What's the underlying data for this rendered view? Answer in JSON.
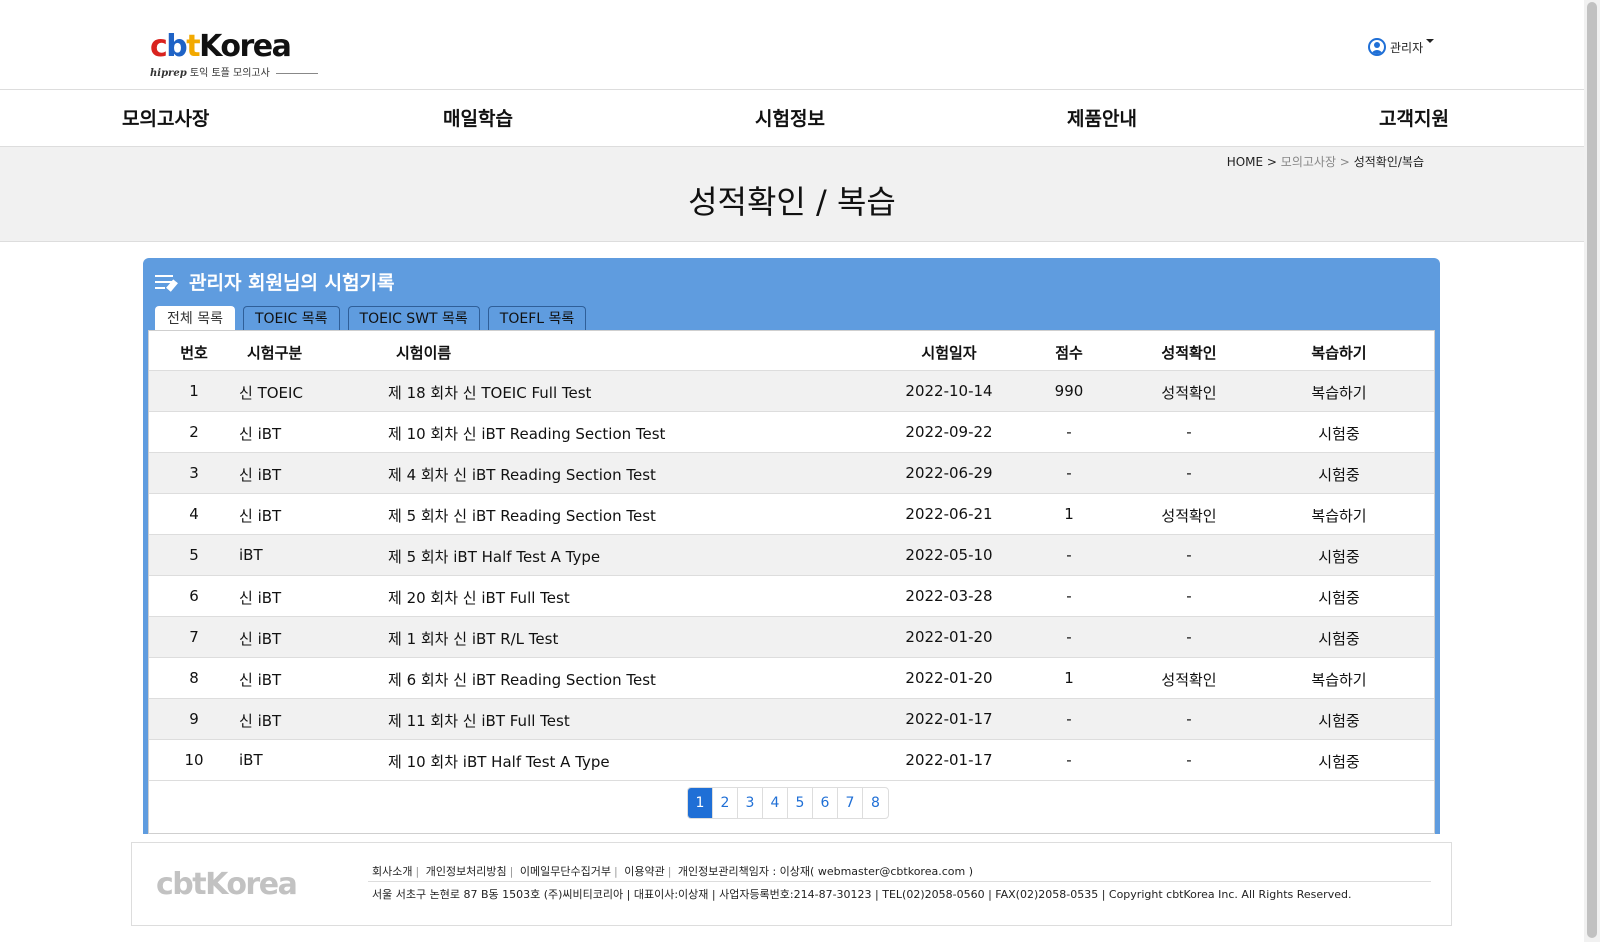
{
  "header": {
    "logo": {
      "c": "c",
      "b": "b",
      "t": "t",
      "korea": "Korea",
      "sub_brand": "hiprep",
      "sub_text": "토익 토플 모의고사"
    },
    "user_label": "관리자"
  },
  "nav": {
    "items": [
      "모의고사장",
      "매일학습",
      "시험정보",
      "제품안내",
      "고객지원"
    ]
  },
  "breadcrumb": {
    "home": "HOME >",
    "section": "모의고사장 >",
    "current": "성적확인/복습"
  },
  "page_title": "성적확인 / 복습",
  "panel": {
    "title": "관리자 회원님의 시험기록",
    "tabs": [
      "전체 목록",
      "TOEIC 목록",
      "TOEIC SWT 목록",
      "TOEFL 목록"
    ],
    "active_tab": 0
  },
  "table": {
    "headers": {
      "num": "번호",
      "type": "시험구분",
      "name": "시험이름",
      "date": "시험일자",
      "score": "점수",
      "result": "성적확인",
      "review": "복습하기"
    },
    "rows": [
      {
        "num": "1",
        "type": "신 TOEIC",
        "name": "제 18 회차 신 TOEIC Full Test",
        "date": "2022-10-14",
        "score": "990",
        "result": "성적확인",
        "review": "복습하기"
      },
      {
        "num": "2",
        "type": "신 iBT",
        "name": "제 10 회차 신 iBT Reading Section Test",
        "date": "2022-09-22",
        "score": "-",
        "result": "-",
        "review": "시험중"
      },
      {
        "num": "3",
        "type": "신 iBT",
        "name": "제 4 회차 신 iBT Reading Section Test",
        "date": "2022-06-29",
        "score": "-",
        "result": "-",
        "review": "시험중"
      },
      {
        "num": "4",
        "type": "신 iBT",
        "name": "제 5 회차 신 iBT Reading Section Test",
        "date": "2022-06-21",
        "score": "1",
        "result": "성적확인",
        "review": "복습하기"
      },
      {
        "num": "5",
        "type": "iBT",
        "name": "제 5 회차 iBT Half Test A Type",
        "date": "2022-05-10",
        "score": "-",
        "result": "-",
        "review": "시험중"
      },
      {
        "num": "6",
        "type": "신 iBT",
        "name": "제 20 회차 신 iBT Full Test",
        "date": "2022-03-28",
        "score": "-",
        "result": "-",
        "review": "시험중"
      },
      {
        "num": "7",
        "type": "신 iBT",
        "name": "제 1 회차 신 iBT R/L Test",
        "date": "2022-01-20",
        "score": "-",
        "result": "-",
        "review": "시험중"
      },
      {
        "num": "8",
        "type": "신 iBT",
        "name": "제 6 회차 신 iBT Reading Section Test",
        "date": "2022-01-20",
        "score": "1",
        "result": "성적확인",
        "review": "복습하기"
      },
      {
        "num": "9",
        "type": "신 iBT",
        "name": "제 11 회차 신 iBT Full Test",
        "date": "2022-01-17",
        "score": "-",
        "result": "-",
        "review": "시험중"
      },
      {
        "num": "10",
        "type": "iBT",
        "name": "제 10 회차 iBT Half Test A Type",
        "date": "2022-01-17",
        "score": "-",
        "result": "-",
        "review": "시험중"
      }
    ]
  },
  "pagination": {
    "pages": [
      "1",
      "2",
      "3",
      "4",
      "5",
      "6",
      "7",
      "8"
    ],
    "current": "1"
  },
  "footer": {
    "logo": "cbtKorea",
    "links": [
      "회사소개",
      "개인정보처리방침",
      "이메일무단수집거부",
      "이용약관"
    ],
    "privacy_officer": "개인정보관리책임자 : 이상재(  webmaster@cbtkorea.com  )",
    "info": "서울 서초구 논현로 87 B동 1503호 (주)씨비티코리아 | 대표이사:이상재 | 사업자등록번호:214-87-30123 | TEL(02)2058-0560 | FAX(02)2058-0535 | Copyright cbtKorea Inc. All Rights Reserved."
  },
  "colors": {
    "panel_blue": "#5f9cdf",
    "link_blue": "#1f6fd6",
    "logo_red": "#d9231f",
    "logo_blue": "#1f63c6",
    "logo_yellow": "#f2a900"
  }
}
